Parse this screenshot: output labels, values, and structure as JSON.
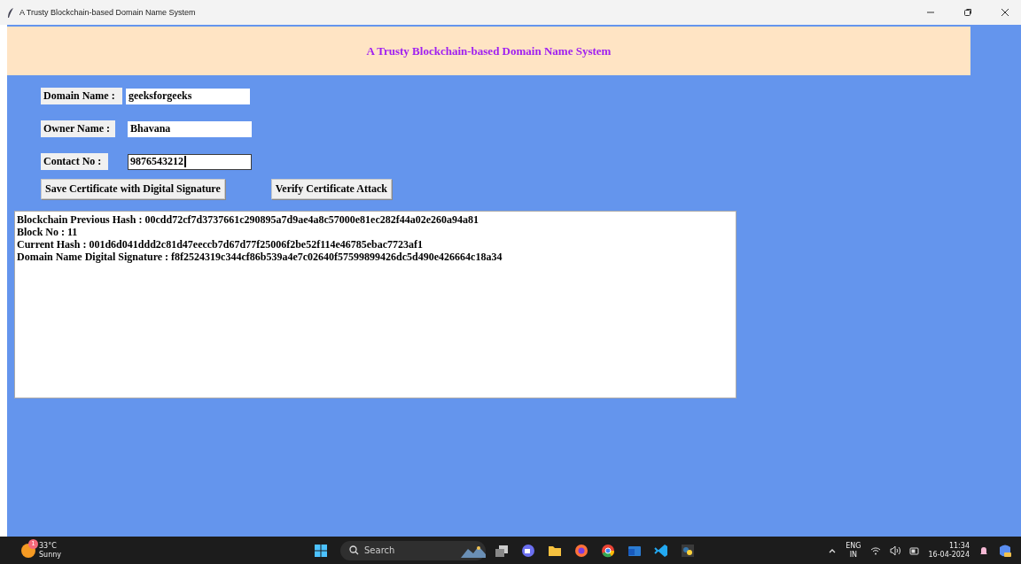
{
  "window": {
    "title": "A Trusty Blockchain-based Domain Name System"
  },
  "header": {
    "title": "A Trusty Blockchain-based Domain Name System"
  },
  "form": {
    "fields": [
      {
        "label": "Domain Name :",
        "value": "geeksforgeeks",
        "focused": false
      },
      {
        "label": "Owner Name :",
        "value": "Bhavana",
        "focused": false
      },
      {
        "label": "Contact No :",
        "value": "9876543212",
        "focused": true
      }
    ]
  },
  "buttons": [
    "Save Certificate with Digital Signature",
    "Verify Certificate Attack"
  ],
  "output": {
    "lines": [
      "Blockchain Previous Hash : 00cdd72cf7d3737661c290895a7d9ae4a8c57000e81ec282f44a02e260a94a81",
      "Block No : 11",
      "Current Hash : 001d6d041ddd2c81d47eeccb7d67d77f25006f2be52f114e46785ebac7723af1",
      "Domain Name Digital Signature : f8f2524319c344cf86b539a4e7c02640f57599899426dc5d490e426664c18a34"
    ]
  },
  "taskbar": {
    "weather": {
      "badge": "1",
      "temperature": "33°C",
      "condition": "Sunny"
    },
    "search": {
      "placeholder": "Search"
    },
    "language": {
      "code": "ENG",
      "region": "IN"
    },
    "clock": {
      "time": "11:34",
      "date": "16-04-2024"
    }
  }
}
